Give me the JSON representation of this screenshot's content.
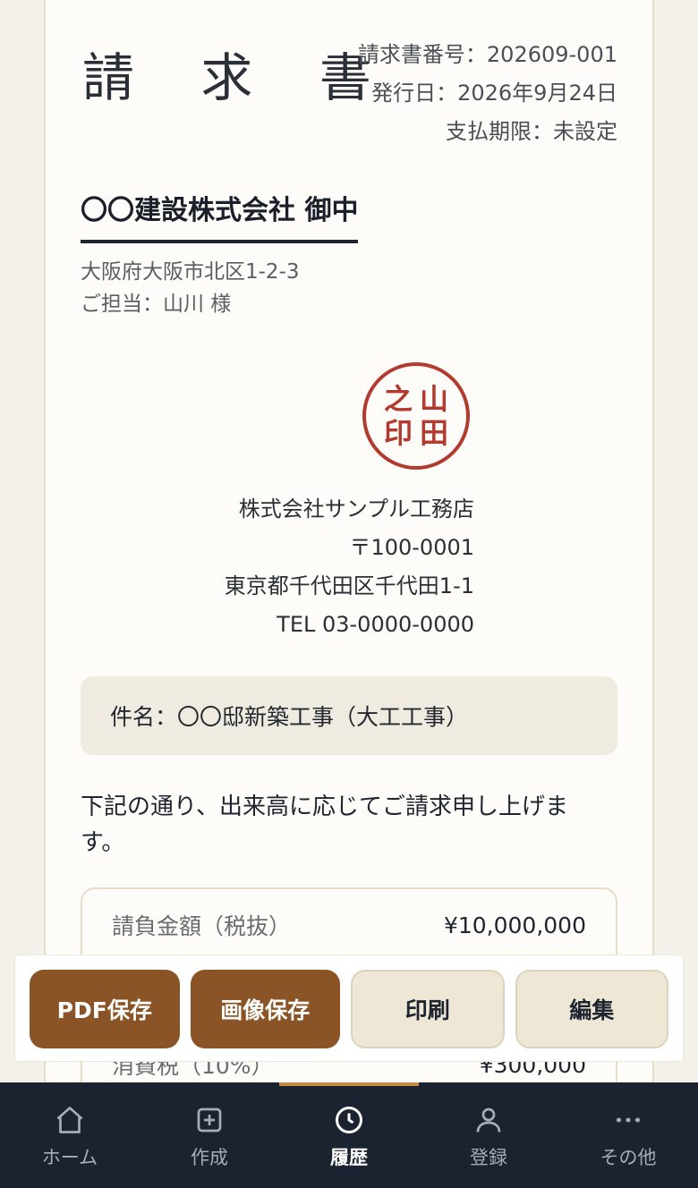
{
  "invoice": {
    "title": "請 求 書",
    "number": "請求書番号：202609-001",
    "issue_date": "発行日：2026年9月24日",
    "due_date": "支払期限：未設定"
  },
  "client": {
    "name": "〇〇建設株式会社 御中",
    "address": "大阪府大阪市北区1-2-3",
    "contact": "ご担当：山川 様"
  },
  "seal": {
    "chars": [
      "山",
      "之",
      "田",
      "印"
    ],
    "color": "#b33a2e"
  },
  "issuer": {
    "company": "株式会社サンプル工務店",
    "postal": "〒100-0001",
    "address": "東京都千代田区千代田1-1",
    "tel": "TEL 03-0000-0000"
  },
  "subject": "件名：〇〇邸新築工事（大工工事）",
  "intro": "下記の通り、出来高に応じてご請求申し上げます。",
  "amounts": [
    {
      "label": "請負金額（税抜）",
      "value": "¥10,000,000"
    },
    {
      "label": "消費税（10%）",
      "value": "¥300,000"
    }
  ],
  "actions": {
    "pdf": "PDF保存",
    "image": "画像保存",
    "print": "印刷",
    "edit": "編集"
  },
  "nav": [
    {
      "label": "ホーム",
      "icon": "home-icon"
    },
    {
      "label": "作成",
      "icon": "plus-square-icon"
    },
    {
      "label": "履歴",
      "icon": "clock-icon",
      "active": true
    },
    {
      "label": "登録",
      "icon": "user-icon"
    },
    {
      "label": "その他",
      "icon": "more-icon"
    }
  ],
  "colors": {
    "accent": "#8b5426",
    "nav_bg": "#1b2331",
    "nav_active_bar": "#c78a45"
  }
}
